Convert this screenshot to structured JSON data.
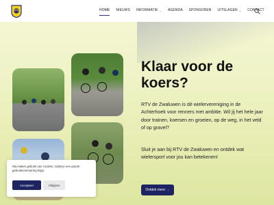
{
  "nav": {
    "items": [
      {
        "label": "HOME",
        "active": true,
        "dropdown": false
      },
      {
        "label": "NIEUWS",
        "active": false,
        "dropdown": false
      },
      {
        "label": "INFORMATIE",
        "active": false,
        "dropdown": true
      },
      {
        "label": "AGENDA",
        "active": false,
        "dropdown": false
      },
      {
        "label": "SPONSOREN",
        "active": false,
        "dropdown": false
      },
      {
        "label": "UITSLAGEN",
        "active": false,
        "dropdown": true
      },
      {
        "label": "CONTACT",
        "active": false,
        "dropdown": false
      }
    ],
    "search_icon": "search-icon"
  },
  "hero": {
    "title": "Klaar voor de koers?",
    "paragraph1": "RTV de Zwaluwen is dé wielervereniging in de Achterhoek voor renners met ambitie. Wil jij het hele jaar door trainen, koersen en groeien, op de weg, in het veld of op gravel?",
    "paragraph2": "Sluit je aan bij RTV de Zwaluwen en ontdek wat wielersport voor jou kan betekenen!",
    "cta_label": "Ontdek meer →"
  },
  "cookie": {
    "text": "Wij maken gebruik van cookies, zodat je een goede gebruikerservaring krijgt.",
    "accept_label": "Accepteer",
    "reject_label": "Afwijzen"
  },
  "colors": {
    "brand_navy": "#1d2461",
    "hero_bg": "#eef2c4"
  }
}
